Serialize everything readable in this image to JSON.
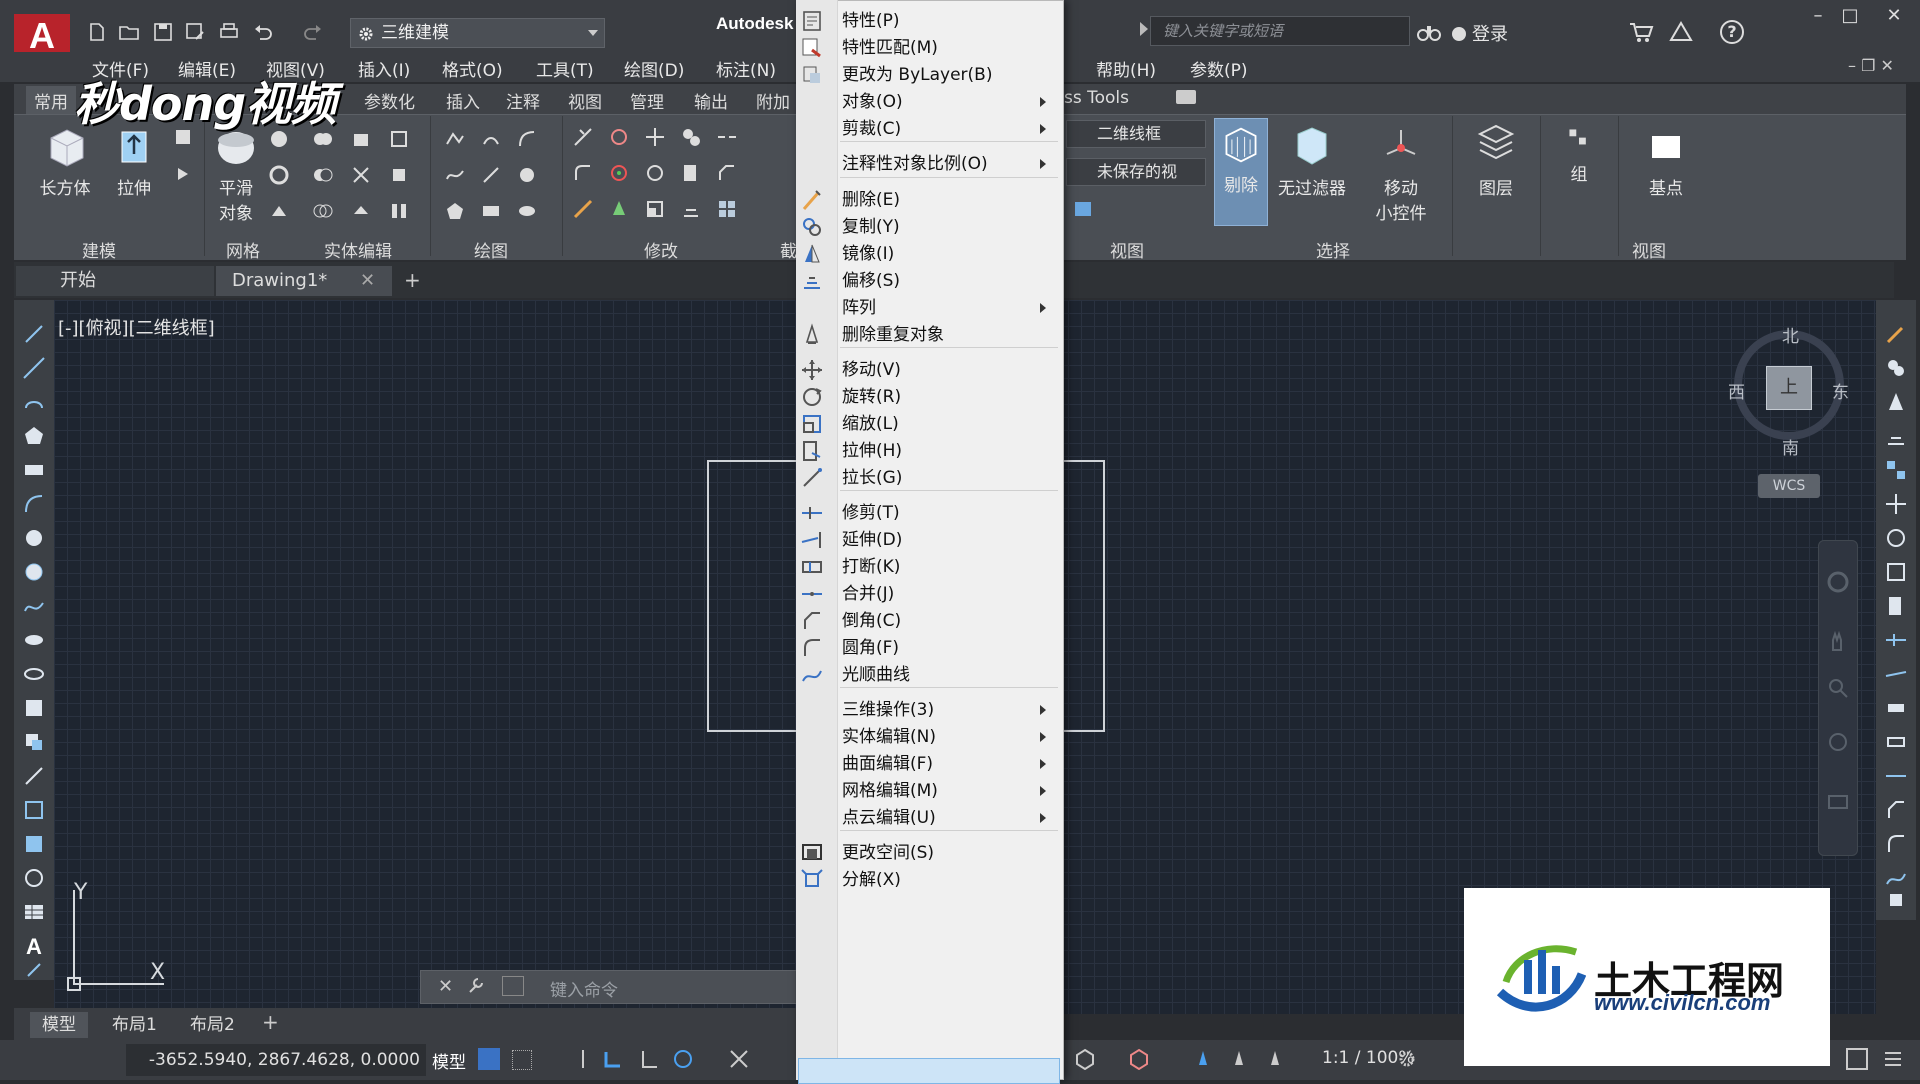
{
  "title_bar": {
    "workspace": "三维建模",
    "brand": "Autodesk",
    "search_placeholder": "键入关键字或短语",
    "signin": "登录"
  },
  "menu_bar": [
    "文件(F)",
    "编辑(E)",
    "视图(V)",
    "插入(I)",
    "格式(O)",
    "工具(T)",
    "绘图(D)",
    "标注(N)",
    "帮助(H)",
    "参数(P)"
  ],
  "ribbon": {
    "tabs": [
      "常用",
      "参数化",
      "插入",
      "注释",
      "视图",
      "管理",
      "输出",
      "附加"
    ],
    "tab_partial": "ss Tools",
    "buttons": {
      "box": "长方体",
      "extrude": "拉伸",
      "smooth1": "平滑",
      "smooth2": "对象",
      "cull": "剔除",
      "no_filter": "无过滤器",
      "gizmo1": "移动",
      "gizmo2": "小控件",
      "layers": "图层",
      "group": "组",
      "base": "基点"
    },
    "style_dropdown": "二维线框",
    "view_dropdown": "未保存的视",
    "panels": [
      "建模",
      "网格",
      "实体编辑",
      "绘图",
      "修改",
      "截",
      "视图",
      "选择",
      "视图"
    ]
  },
  "doc_tabs": {
    "start": "开始",
    "drawing": "Drawing1*"
  },
  "viewport": {
    "label": "[-][俯视][二维线框]",
    "compass": {
      "n": "北",
      "s": "南",
      "e": "东",
      "w": "西"
    },
    "cube_face": "上",
    "wcs": "WCS",
    "ucs_x": "X",
    "ucs_y": "Y"
  },
  "command_line": {
    "placeholder": "键入命令"
  },
  "layout_tabs": [
    "模型",
    "布局1",
    "布局2"
  ],
  "status_bar": {
    "coords": "-3652.5940, 2867.4628, 0.0000",
    "mode": "模型",
    "scale": "1:1 / 100%"
  },
  "context_menu": {
    "items": [
      {
        "label": "特性(P)",
        "icon": "properties-icon"
      },
      {
        "label": "特性匹配(M)",
        "icon": "match-properties-icon"
      },
      {
        "label": "更改为 ByLayer(B)",
        "icon": "bylayer-icon"
      },
      {
        "label": "对象(O)",
        "submenu": true
      },
      {
        "label": "剪裁(C)",
        "submenu": true
      },
      {
        "label": "注释性对象比例(O)",
        "submenu": true
      },
      {
        "label": "删除(E)",
        "icon": "erase-icon"
      },
      {
        "label": "复制(Y)",
        "icon": "copy-icon"
      },
      {
        "label": "镜像(I)",
        "icon": "mirror-icon"
      },
      {
        "label": "偏移(S)",
        "icon": "offset-icon"
      },
      {
        "label": "阵列",
        "submenu": true
      },
      {
        "label": "删除重复对象",
        "icon": "overkill-icon"
      },
      {
        "label": "移动(V)",
        "icon": "move-icon"
      },
      {
        "label": "旋转(R)",
        "icon": "rotate-icon"
      },
      {
        "label": "缩放(L)",
        "icon": "scale-icon"
      },
      {
        "label": "拉伸(H)",
        "icon": "stretch-icon"
      },
      {
        "label": "拉长(G)",
        "icon": "lengthen-icon"
      },
      {
        "label": "修剪(T)",
        "icon": "trim-icon"
      },
      {
        "label": "延伸(D)",
        "icon": "extend-icon"
      },
      {
        "label": "打断(K)",
        "icon": "break-icon"
      },
      {
        "label": "合并(J)",
        "icon": "join-icon"
      },
      {
        "label": "倒角(C)",
        "icon": "chamfer-icon"
      },
      {
        "label": "圆角(F)",
        "icon": "fillet-icon"
      },
      {
        "label": "光顺曲线",
        "icon": "blend-icon"
      },
      {
        "label": "三维操作(3)",
        "submenu": true
      },
      {
        "label": "实体编辑(N)",
        "submenu": true
      },
      {
        "label": "曲面编辑(F)",
        "submenu": true
      },
      {
        "label": "网格编辑(M)",
        "submenu": true
      },
      {
        "label": "点云编辑(U)",
        "submenu": true
      },
      {
        "label": "更改空间(S)",
        "icon": "change-space-icon"
      },
      {
        "label": "分解(X)",
        "icon": "explode-icon",
        "highlighted": true
      }
    ]
  },
  "watermarks": {
    "top": "秒dong视频",
    "site_cn": "土木工程网",
    "site_url": "www.civilcn.com"
  },
  "colors": {
    "canvas": "#1e2530",
    "ui_dark": "#3a3d42",
    "menu_bg": "#f0f0f0",
    "highlight": "#cde4f7",
    "logo_red": "#b8232b"
  }
}
